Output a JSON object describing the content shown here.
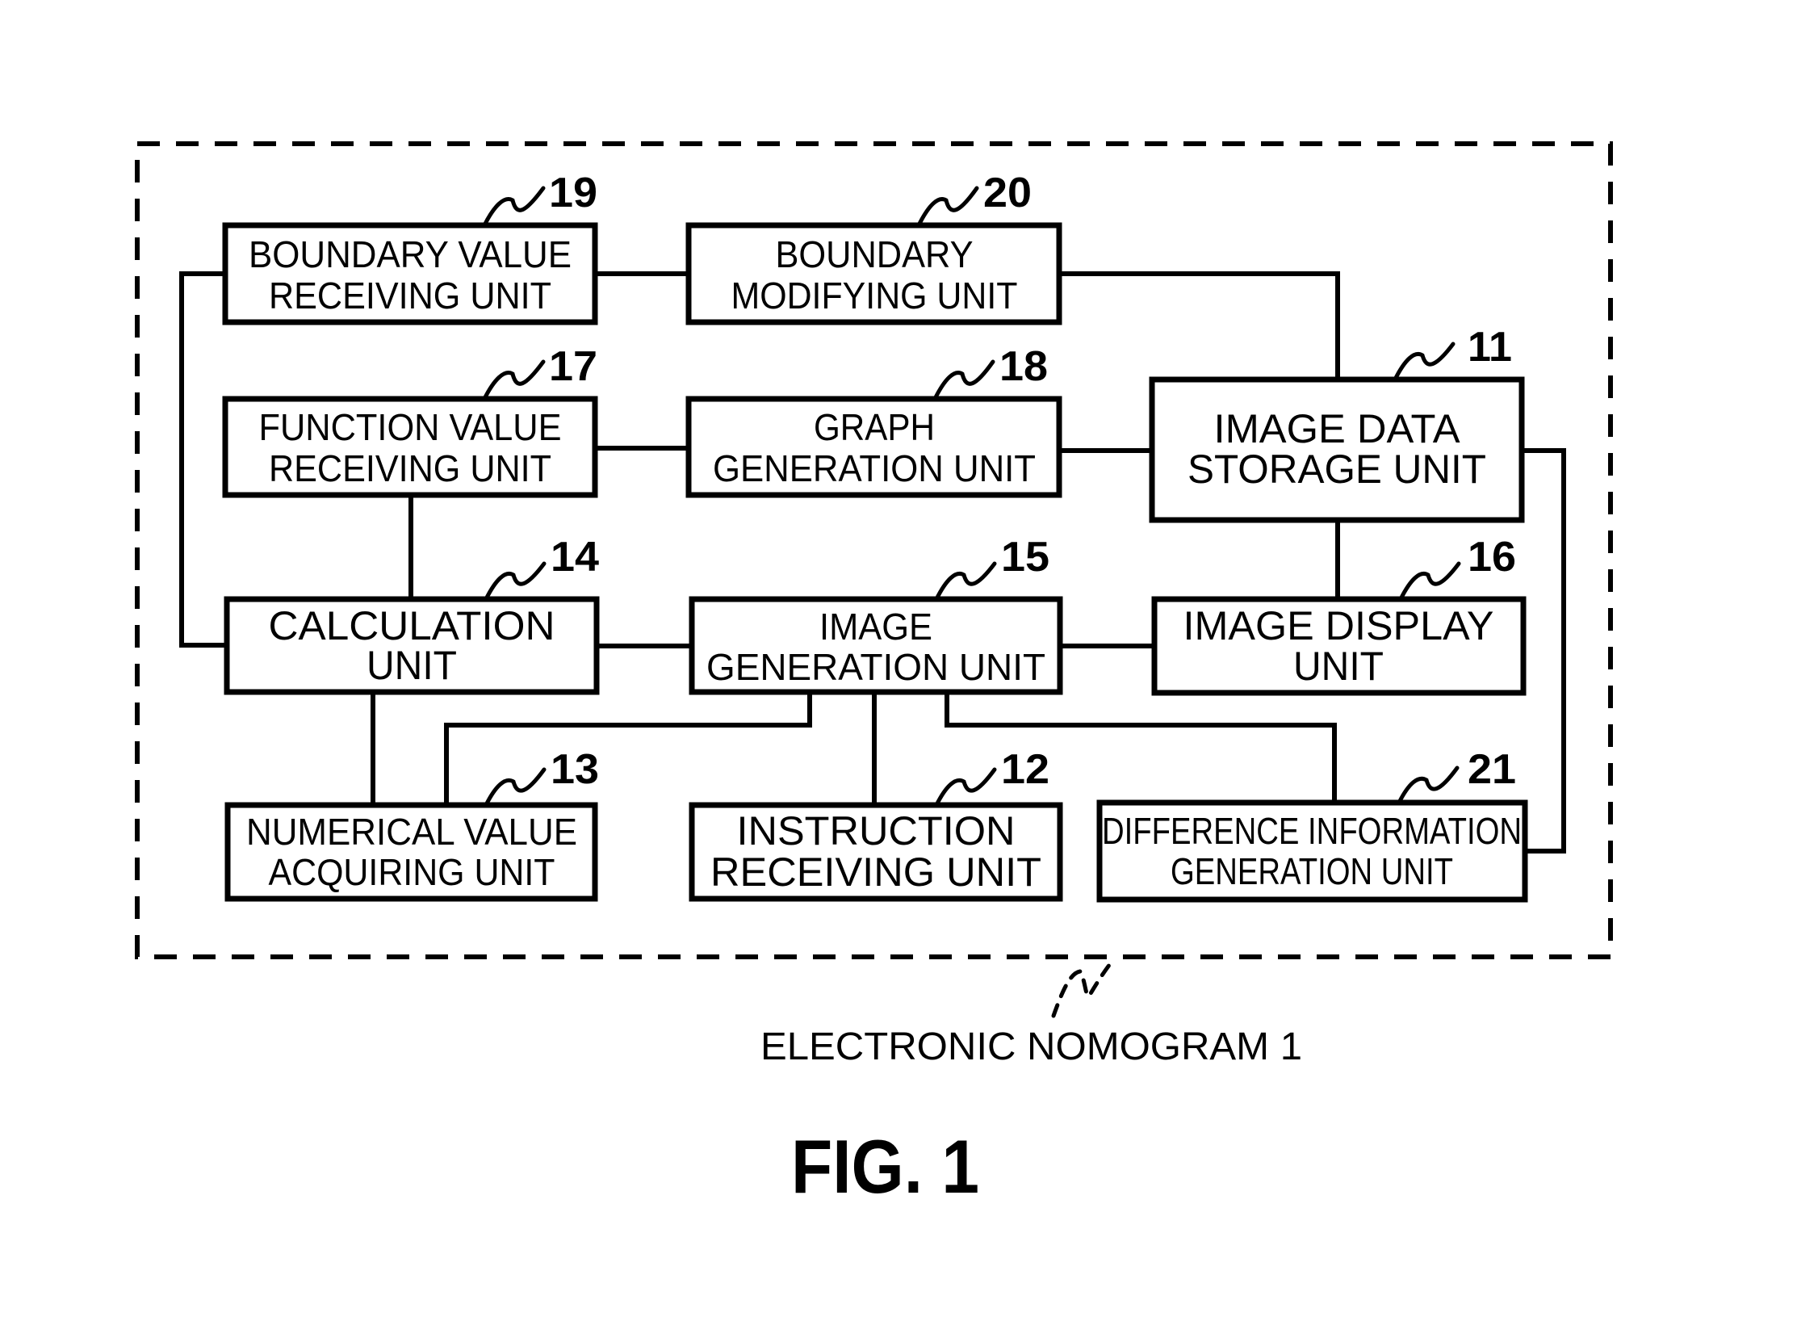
{
  "figure": {
    "title": "FIG. 1",
    "system_label": "ELECTRONIC NOMOGRAM 1"
  },
  "units": {
    "u19": {
      "ref": "19",
      "line1": "BOUNDARY VALUE",
      "line2": "RECEIVING UNIT"
    },
    "u20": {
      "ref": "20",
      "line1": "BOUNDARY",
      "line2": "MODIFYING UNIT"
    },
    "u17": {
      "ref": "17",
      "line1": "FUNCTION VALUE",
      "line2": "RECEIVING UNIT"
    },
    "u18": {
      "ref": "18",
      "line1": "GRAPH",
      "line2": "GENERATION UNIT"
    },
    "u11": {
      "ref": "11",
      "line1": "IMAGE DATA",
      "line2": "STORAGE UNIT"
    },
    "u14": {
      "ref": "14",
      "line1": "CALCULATION",
      "line2": "UNIT"
    },
    "u15": {
      "ref": "15",
      "line1": "IMAGE",
      "line2": "GENERATION UNIT"
    },
    "u16": {
      "ref": "16",
      "line1": "IMAGE DISPLAY",
      "line2": "UNIT"
    },
    "u13": {
      "ref": "13",
      "line1": "NUMERICAL VALUE",
      "line2": "ACQUIRING UNIT"
    },
    "u12": {
      "ref": "12",
      "line1": "INSTRUCTION",
      "line2": "RECEIVING UNIT"
    },
    "u21": {
      "ref": "21",
      "line1": "DIFFERENCE INFORMATION",
      "line2": "GENERATION UNIT"
    }
  },
  "connections": [
    [
      "u19",
      "u20"
    ],
    [
      "u20",
      "u11"
    ],
    [
      "u19",
      "u14"
    ],
    [
      "u17",
      "u18"
    ],
    [
      "u18",
      "u11"
    ],
    [
      "u17",
      "u14"
    ],
    [
      "u14",
      "u15"
    ],
    [
      "u15",
      "u16"
    ],
    [
      "u11",
      "u16"
    ],
    [
      "u14",
      "u13"
    ],
    [
      "u15",
      "u13"
    ],
    [
      "u15",
      "u12"
    ],
    [
      "u15",
      "u21"
    ],
    [
      "u11",
      "u21"
    ]
  ]
}
